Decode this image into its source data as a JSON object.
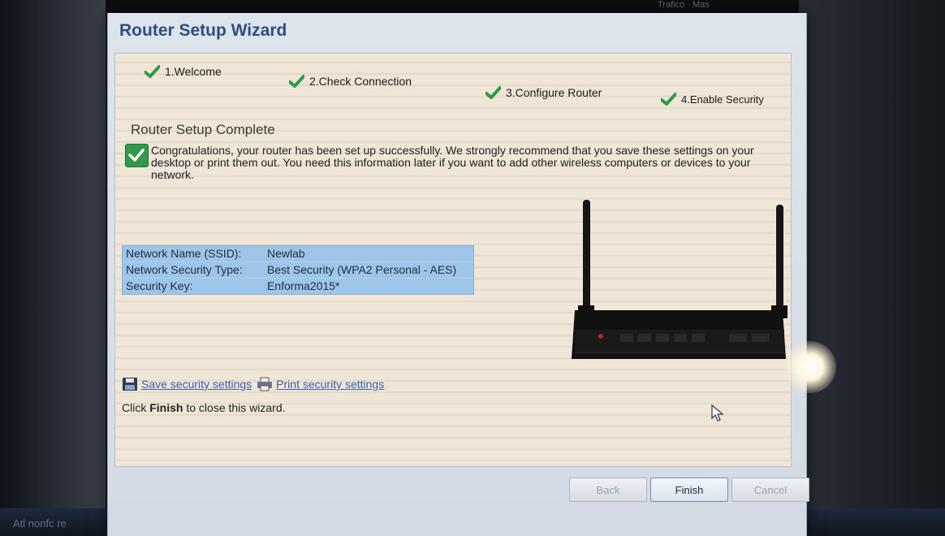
{
  "window": {
    "title": "Router Setup Wizard"
  },
  "background": {
    "tabs_text": "Trafico · Mas",
    "taskbar_text": "Atl nonfc re"
  },
  "steps": [
    {
      "label": "1.Welcome"
    },
    {
      "label": "2.Check Connection"
    },
    {
      "label": "3.Configure Router"
    },
    {
      "label": "4.Enable Security"
    }
  ],
  "page": {
    "heading": "Router Setup Complete",
    "congrats": "Congratulations, your router has been set up successfully. We strongly recommend that you save these settings on your desktop or print them out. You need this information later if you want to add other wireless computers or devices to your network."
  },
  "settings": [
    {
      "label": "Network Name (SSID):",
      "value": "Newlab"
    },
    {
      "label": "Network Security Type:",
      "value": "Best Security (WPA2 Personal - AES)"
    },
    {
      "label": "Security Key:",
      "value": "Enforma2015*"
    }
  ],
  "links": {
    "save": "Save security settings",
    "print": "Print security settings"
  },
  "finish_note": {
    "prefix": "Click ",
    "bold": "Finish",
    "suffix": " to close this wizard."
  },
  "buttons": {
    "back": "Back",
    "finish": "Finish",
    "cancel": "Cancel"
  },
  "icons": {
    "step": "check-icon",
    "congrats": "success-check-icon",
    "save": "floppy-disk-icon",
    "print": "printer-icon"
  },
  "colors": {
    "title": "#2f4d7f",
    "check": "#2f9a4a",
    "settings_bg": "#9ec4e8",
    "link": "#3d5fa8"
  }
}
